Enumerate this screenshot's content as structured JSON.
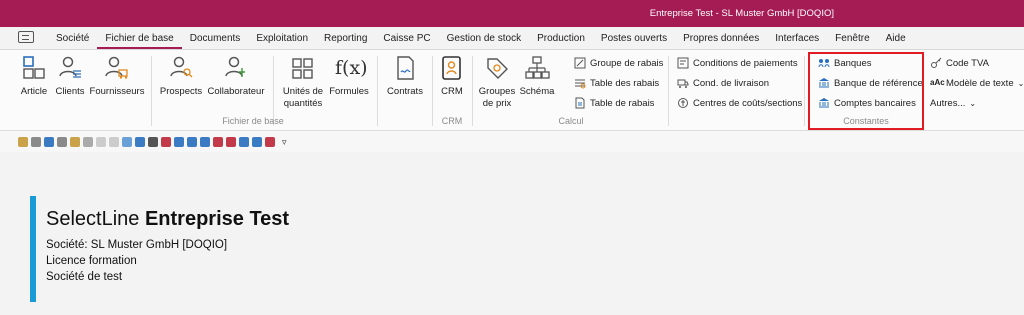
{
  "window": {
    "title": "Entreprise Test - SL Muster GmbH [DOQIO]"
  },
  "menu": {
    "tabs": [
      "Société",
      "Fichier de base",
      "Documents",
      "Exploitation",
      "Reporting",
      "Caisse PC",
      "Gestion de stock",
      "Production",
      "Postes ouverts",
      "Propres données",
      "Interfaces",
      "Fenêtre",
      "Aide"
    ],
    "active": "Fichier de base"
  },
  "ribbon": {
    "article": "Article",
    "clients": "Clients",
    "fournisseurs": "Fournisseurs",
    "prospects": "Prospects",
    "collaborateur": "Collaborateur",
    "unites_line1": "Unités de",
    "unites_line2": "quantités",
    "formules": "Formules",
    "contrats": "Contrats",
    "crm": "CRM",
    "groupes_line1": "Groupes",
    "groupes_line2": "de prix",
    "schema": "Schéma",
    "groupe_rabais": "Groupe de rabais",
    "table_des_rabais": "Table des rabais",
    "table_de_rabais": "Table de rabais",
    "conditions_paiements": "Conditions de paiements",
    "cond_livraison": "Cond. de livraison",
    "centres_couts": "Centres de coûts/sections",
    "banques": "Banques",
    "banque_reference": "Banque de référence",
    "comptes_bancaires": "Comptes bancaires",
    "code_tva": "Code TVA",
    "modele_texte": "Modèle de texte",
    "autres": "Autres...",
    "group_fichier": "Fichier de base",
    "group_crm": "CRM",
    "group_calcul": "Calcul",
    "group_constantes": "Constantes"
  },
  "main": {
    "brand": "SelectLine",
    "product": "Entreprise Test",
    "societe": "Société: SL Muster GmbH [DOQIO]",
    "licence": "Licence formation",
    "societe_test": "Société de test"
  },
  "colors": {
    "titlebar": "#a51c55",
    "accent": "#1a9ad6",
    "highlight": "#e01b24"
  }
}
